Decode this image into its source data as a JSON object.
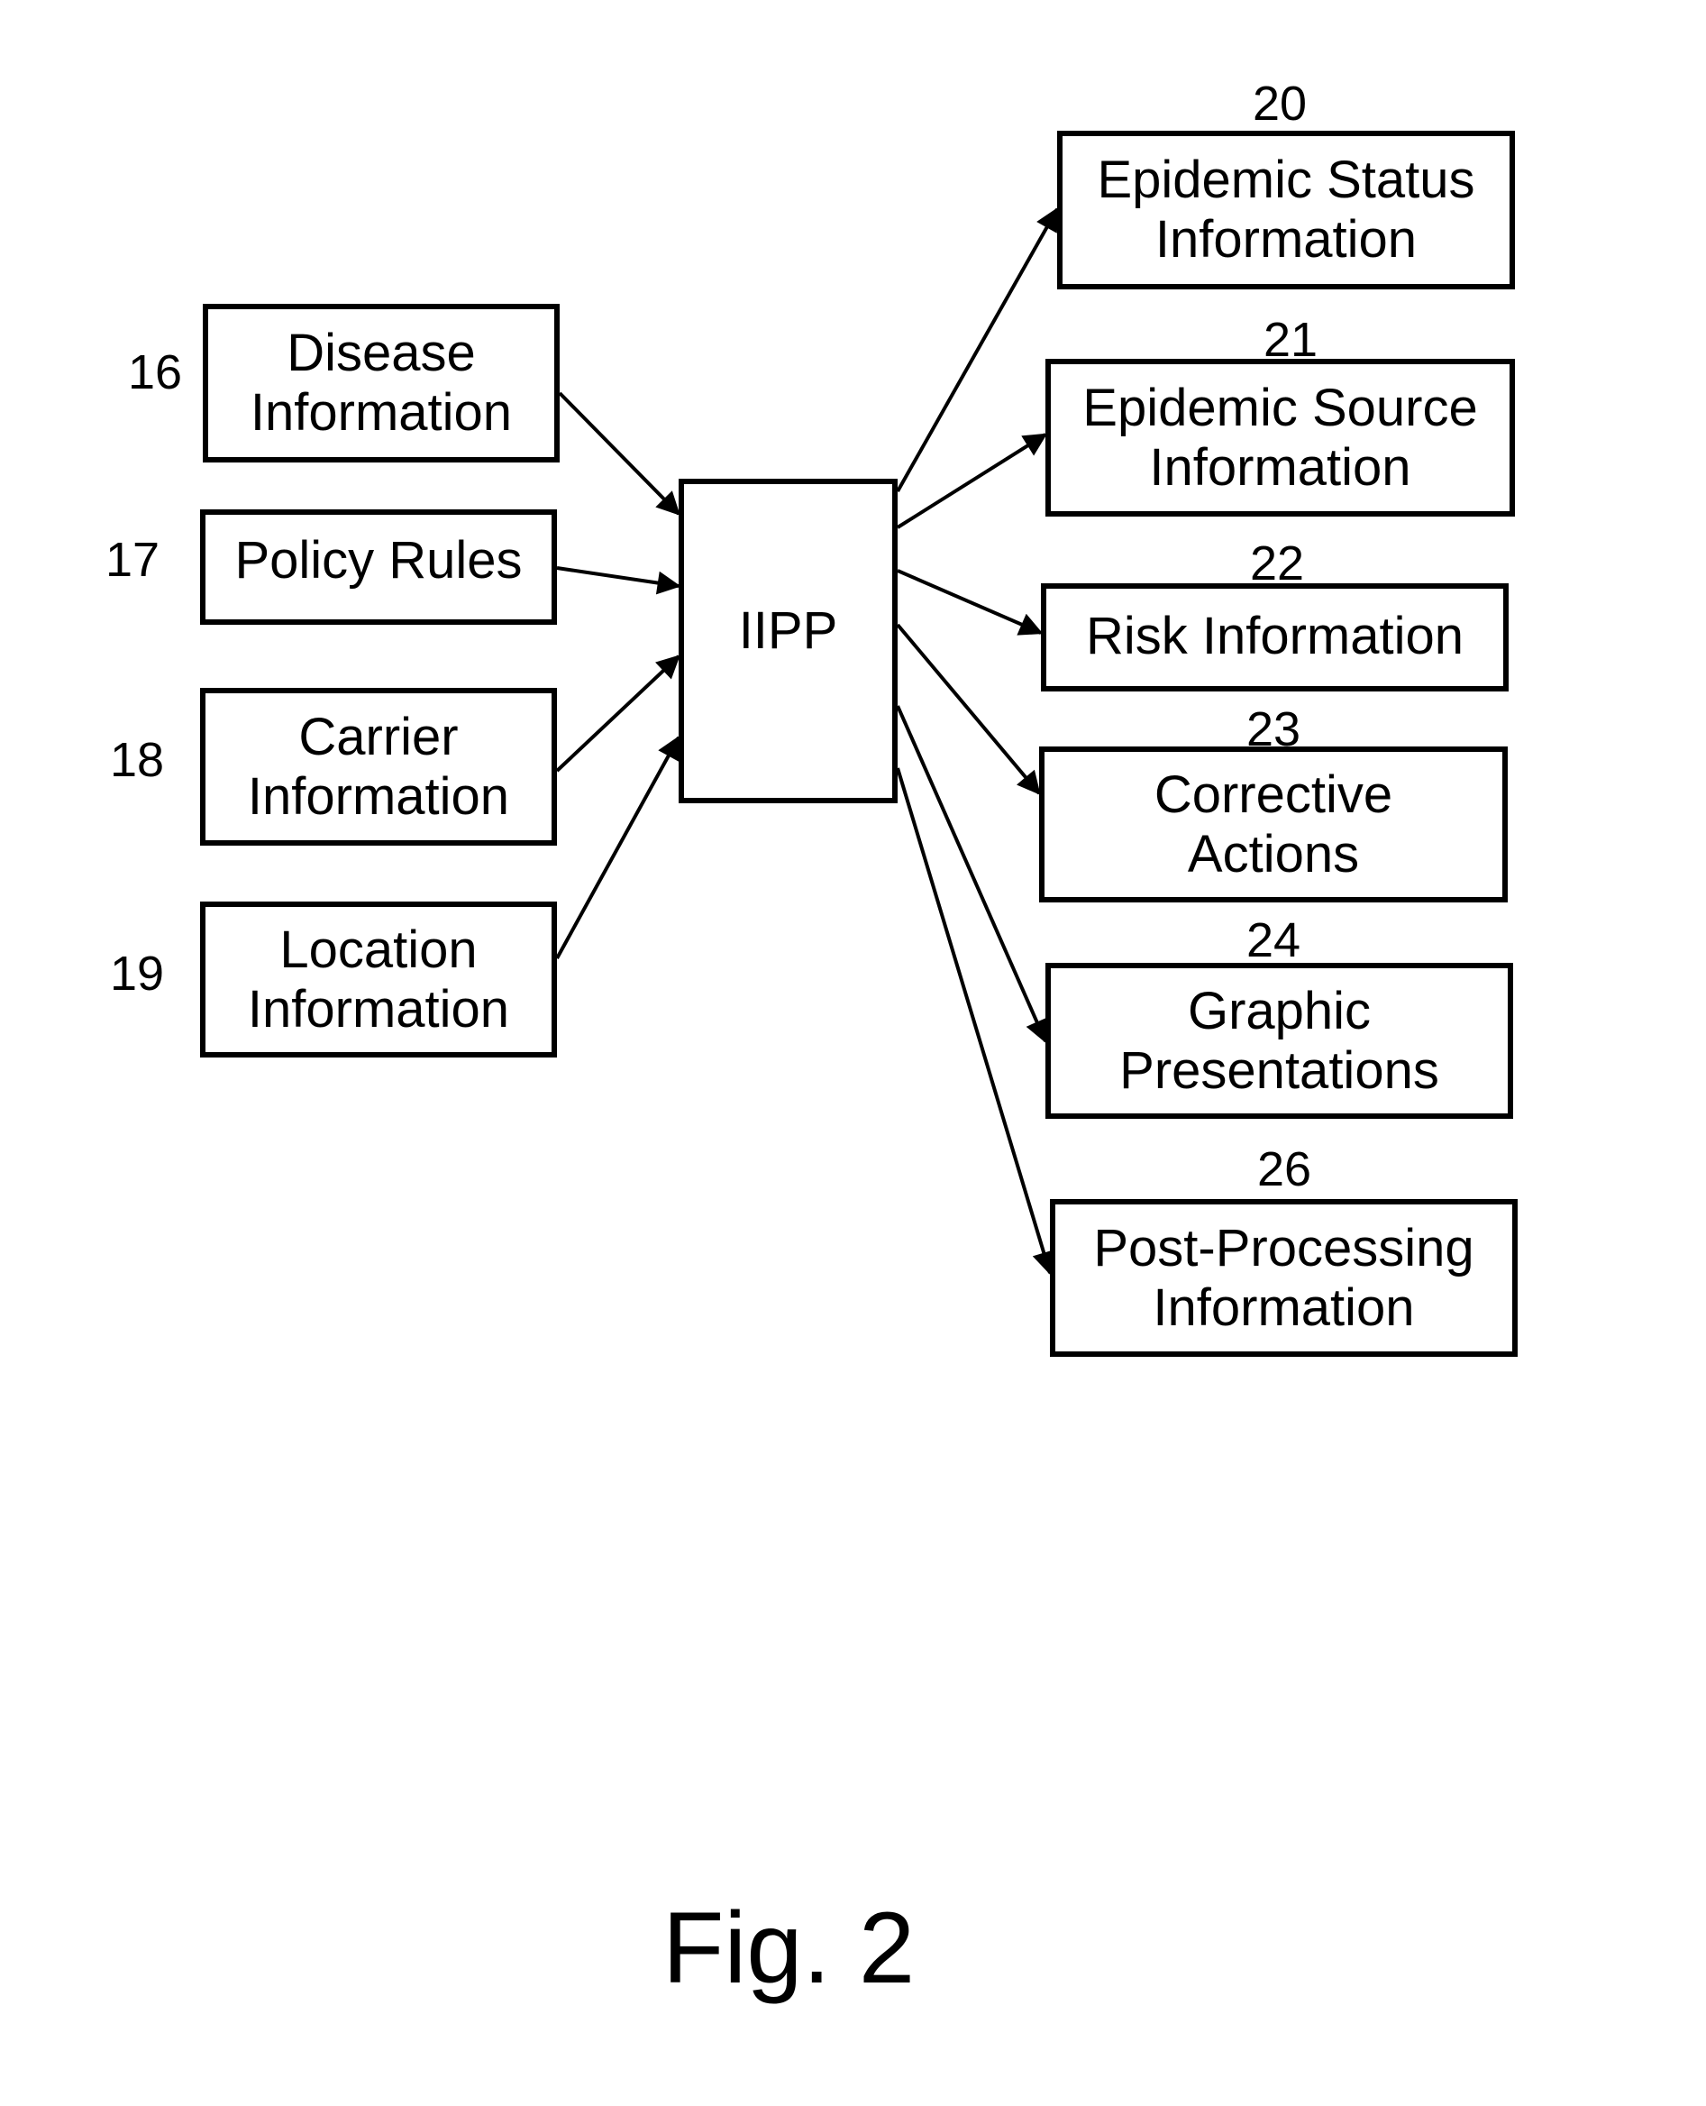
{
  "figure": {
    "caption": "Fig. 2",
    "hub": {
      "id": "iipp",
      "label": "IIPP"
    },
    "inputs": [
      {
        "id": "disease",
        "ref": "16",
        "lines": [
          "Disease",
          "Information"
        ]
      },
      {
        "id": "policy",
        "ref": "17",
        "lines": [
          "Policy Rules"
        ]
      },
      {
        "id": "carrier",
        "ref": "18",
        "lines": [
          "Carrier",
          "Information"
        ]
      },
      {
        "id": "location",
        "ref": "19",
        "lines": [
          "Location",
          "Information"
        ]
      }
    ],
    "outputs": [
      {
        "id": "epidemic-status",
        "ref": "20",
        "lines": [
          "Epidemic Status",
          "Information"
        ]
      },
      {
        "id": "epidemic-source",
        "ref": "21",
        "lines": [
          "Epidemic Source",
          "Information"
        ]
      },
      {
        "id": "risk",
        "ref": "22",
        "lines": [
          "Risk Information"
        ]
      },
      {
        "id": "corrective",
        "ref": "23",
        "lines": [
          "Corrective",
          "Actions"
        ]
      },
      {
        "id": "graphic",
        "ref": "24",
        "lines": [
          "Graphic",
          "Presentations"
        ]
      },
      {
        "id": "post-processing",
        "ref": "26",
        "lines": [
          "Post-Processing",
          "Information"
        ]
      }
    ],
    "edges": [
      {
        "from": "disease",
        "to": "iipp"
      },
      {
        "from": "policy",
        "to": "iipp"
      },
      {
        "from": "carrier",
        "to": "iipp"
      },
      {
        "from": "location",
        "to": "iipp"
      },
      {
        "from": "iipp",
        "to": "epidemic-status"
      },
      {
        "from": "iipp",
        "to": "epidemic-source"
      },
      {
        "from": "iipp",
        "to": "risk"
      },
      {
        "from": "iipp",
        "to": "corrective"
      },
      {
        "from": "iipp",
        "to": "graphic"
      },
      {
        "from": "iipp",
        "to": "post-processing"
      }
    ]
  }
}
